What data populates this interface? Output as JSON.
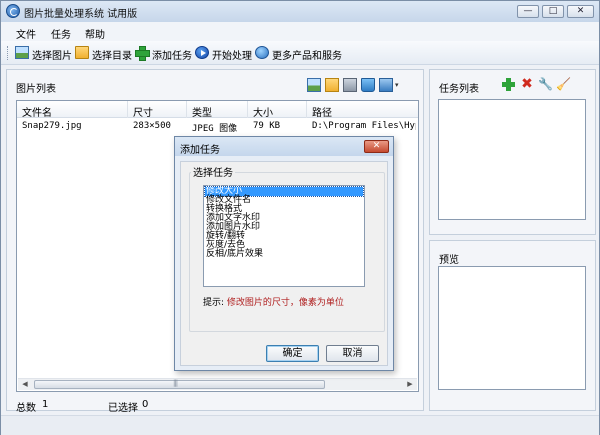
{
  "window": {
    "title": "图片批量处理系统 试用版",
    "min_glyph": "—",
    "max_glyph": "□",
    "close_glyph": "✕"
  },
  "menu": [
    "文件",
    "任务",
    "帮助"
  ],
  "toolbar": {
    "select_images": "选择图片",
    "select_folder": "选择目录",
    "add_task": "添加任务",
    "start_process": "开始处理",
    "more_products": "更多产品和服务"
  },
  "image_list": {
    "title": "图片列表",
    "columns": [
      "文件名",
      "尺寸",
      "类型",
      "大小",
      "路径"
    ],
    "rows": [
      {
        "name": "Snap279.jpg",
        "dimensions": "283×500",
        "type": "JPEG 图像",
        "size": "79 KB",
        "path": "D:\\Program Files\\HyperSn"
      }
    ]
  },
  "task_panel": {
    "title": "任务列表"
  },
  "preview_panel": {
    "title": "预览"
  },
  "status": {
    "total_label": "总数",
    "total_value": "1",
    "selected_label": "已选择",
    "selected_value": "0"
  },
  "dialog": {
    "title": "添加任务",
    "close_glyph": "✕",
    "group_label": "选择任务",
    "options": [
      "修改大小",
      "修改文件名",
      "转换格式",
      "添加文字水印",
      "添加图片水印",
      "旋转/翻转",
      "灰度/去色",
      "反相/底片效果"
    ],
    "selected_index": 0,
    "hint_label": "提示:",
    "hint_text": "修改图片的尺寸，像素为单位",
    "ok": "确定",
    "cancel": "取消"
  },
  "colors": {
    "selection": "#3399ff",
    "hint": "#b02020",
    "plus_green": "#2ea33a",
    "delete_red": "#d02a1e"
  }
}
